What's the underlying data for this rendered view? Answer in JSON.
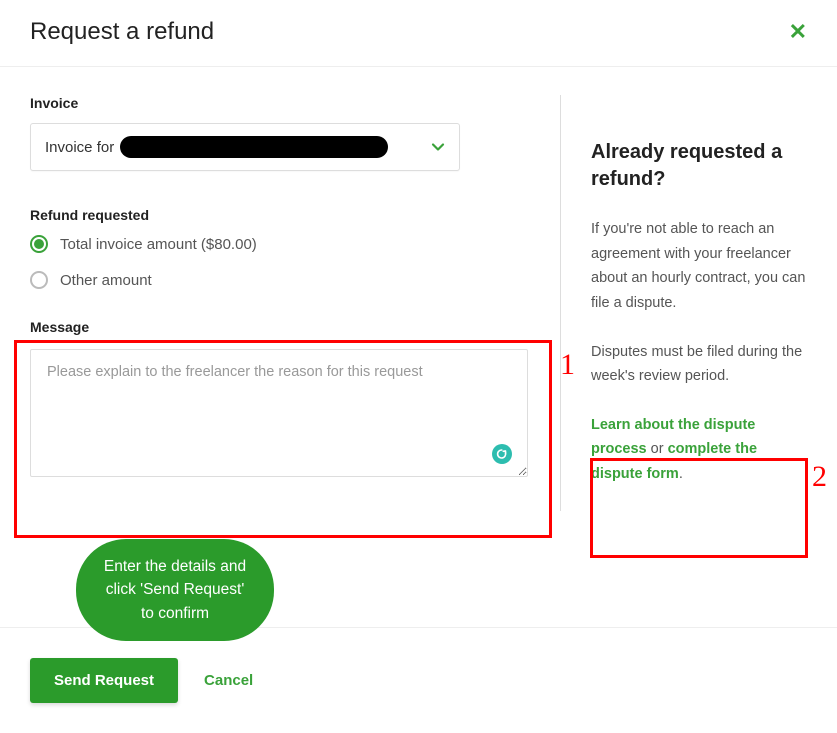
{
  "header": {
    "title": "Request a refund"
  },
  "invoice": {
    "label": "Invoice",
    "prefix": "Invoice for"
  },
  "refund": {
    "label": "Refund requested",
    "total_label": "Total invoice amount ($80.00)",
    "other_label": "Other amount"
  },
  "message": {
    "label": "Message",
    "placeholder": "Please explain to the freelancer the reason for this request"
  },
  "sidebar": {
    "title": "Already requested a refund?",
    "para1": "If you're not able to reach an agreement with your freelancer about an hourly contract, you can file a dispute.",
    "para2": "Disputes must be filed during the week's review period.",
    "link1": "Learn about the dispute process",
    "middle": " or ",
    "link2": "complete the dispute form",
    "end": "."
  },
  "footer": {
    "send": "Send Request",
    "cancel": "Cancel"
  },
  "annotations": {
    "num1": "1",
    "num2": "2",
    "bubble": "Enter the details and click 'Send Request' to confirm"
  }
}
